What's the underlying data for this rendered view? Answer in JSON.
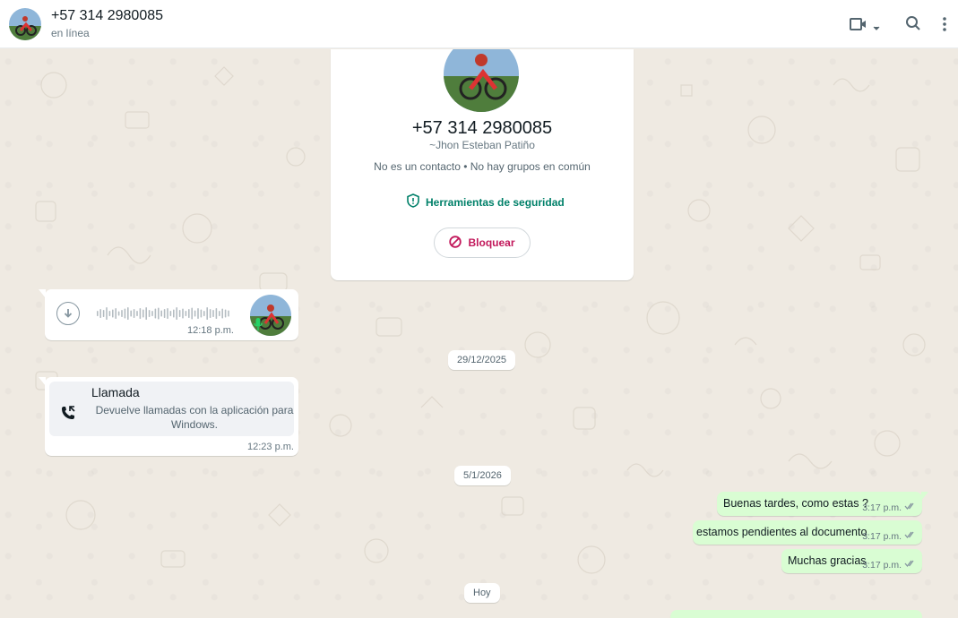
{
  "header": {
    "contact_name": "+57 314 2980085",
    "status": "en línea",
    "icons": [
      "video-call-icon",
      "chevron-down-icon",
      "search-icon",
      "menu-icon"
    ]
  },
  "profile_card": {
    "phone": "+57 314 2980085",
    "alias": "~Jhon Esteban Patiño",
    "meta": "No es un contacto • No hay grupos en común",
    "security_label": "Herramientas de seguridad",
    "block_label": "Bloquear"
  },
  "messages": {
    "voice": {
      "time": "12:18 p.m.",
      "played_fraction": 0
    },
    "date_1": "29/12/2025",
    "call": {
      "title": "Llamada",
      "description": "Devuelve llamadas con la aplicación para Windows.",
      "time": "12:23 p.m."
    },
    "date_2": "5/1/2026",
    "outgoing": [
      {
        "text": "Buenas tardes, como estas ?",
        "time": "3:17 p.m."
      },
      {
        "text": "estamos pendientes al documento",
        "time": "3:17 p.m."
      },
      {
        "text": "Muchas gracias",
        "time": "3:17 p.m."
      }
    ],
    "date_3": "Hoy"
  },
  "colors": {
    "chat_background": "#efeae2",
    "outgoing_bubble": "#d9fdd3",
    "security_green": "#008069",
    "block_red": "#c2185b",
    "read_tick": "#53bdeb"
  }
}
